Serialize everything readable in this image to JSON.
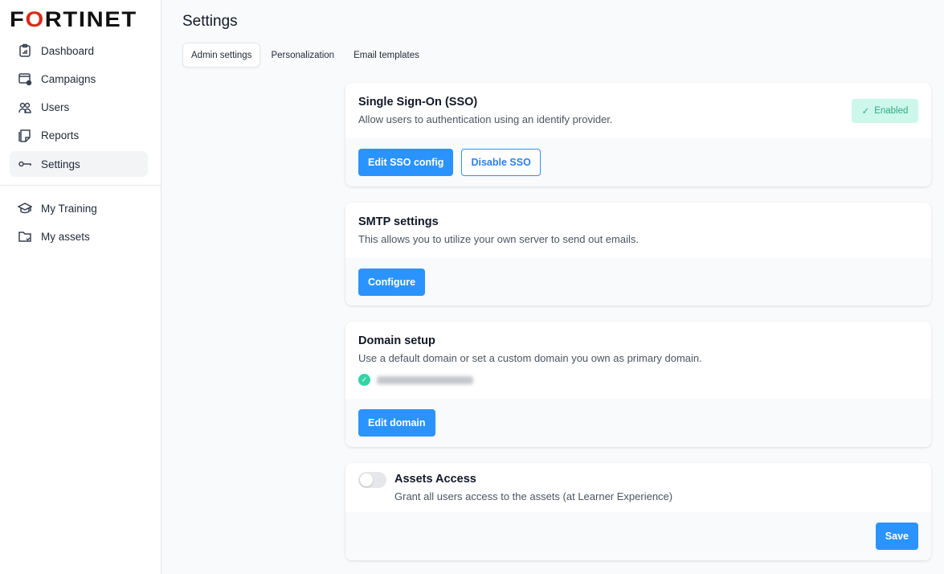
{
  "brand": {
    "name": "FORTINET",
    "accent": "#da291c"
  },
  "sidebar": {
    "items": [
      {
        "label": "Dashboard",
        "icon": "clipboard-chart-icon"
      },
      {
        "label": "Campaigns",
        "icon": "campaign-window-icon"
      },
      {
        "label": "Users",
        "icon": "users-icon"
      },
      {
        "label": "Reports",
        "icon": "note-icon"
      },
      {
        "label": "Settings",
        "icon": "key-icon",
        "active": true
      }
    ],
    "secondary": [
      {
        "label": "My Training",
        "icon": "graduation-cap-icon"
      },
      {
        "label": "My assets",
        "icon": "folder-check-icon"
      }
    ]
  },
  "page": {
    "title": "Settings",
    "tabs": [
      "Admin settings",
      "Personalization",
      "Email templates"
    ]
  },
  "sso": {
    "title": "Single Sign-On (SSO)",
    "desc": "Allow users to authentication using an identify provider.",
    "status": "Enabled",
    "edit": "Edit SSO config",
    "disable": "Disable SSO"
  },
  "smtp": {
    "title": "SMTP settings",
    "desc": "This allows you to utilize your own server to send out emails.",
    "configure": "Configure"
  },
  "domain": {
    "title": "Domain setup",
    "desc": "Use a default domain or set a custom domain you own as primary domain.",
    "edit": "Edit domain"
  },
  "assets": {
    "title": "Assets Access",
    "desc": "Grant all users access to the assets (at Learner Experience)",
    "enabled": false,
    "save": "Save"
  },
  "colors": {
    "primary": "#2b93fd",
    "success_bg": "#cdf7eb",
    "success_text": "#2faa85"
  }
}
